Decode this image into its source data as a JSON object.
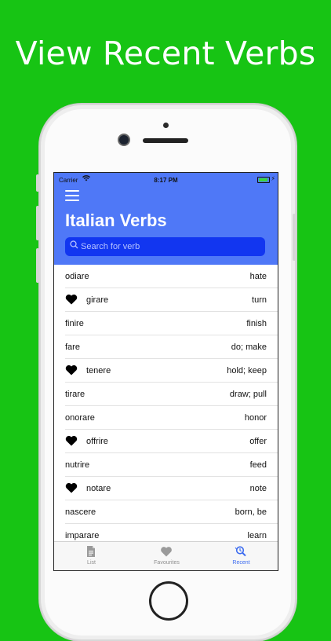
{
  "headline": "View Recent Verbs",
  "status": {
    "carrier": "Carrier",
    "time": "8:17 PM",
    "battery_level": 0.95
  },
  "app": {
    "title": "Italian Verbs"
  },
  "search": {
    "placeholder": "Search for verb",
    "value": ""
  },
  "verbs": [
    {
      "verb": "odiare",
      "meaning": "hate",
      "favourite": false
    },
    {
      "verb": "girare",
      "meaning": "turn",
      "favourite": true
    },
    {
      "verb": "finire",
      "meaning": "finish",
      "favourite": false
    },
    {
      "verb": "fare",
      "meaning": "do; make",
      "favourite": false
    },
    {
      "verb": "tenere",
      "meaning": "hold; keep",
      "favourite": true
    },
    {
      "verb": "tirare",
      "meaning": "draw; pull",
      "favourite": false
    },
    {
      "verb": "onorare",
      "meaning": "honor",
      "favourite": false
    },
    {
      "verb": "offrire",
      "meaning": "offer",
      "favourite": true
    },
    {
      "verb": "nutrire",
      "meaning": "feed",
      "favourite": false
    },
    {
      "verb": "notare",
      "meaning": "note",
      "favourite": true
    },
    {
      "verb": "nascere",
      "meaning": "born, be",
      "favourite": false
    },
    {
      "verb": "imparare",
      "meaning": "learn",
      "favourite": false
    }
  ],
  "tabs": [
    {
      "label": "List",
      "icon": "document-icon",
      "active": false
    },
    {
      "label": "Favourites",
      "icon": "heart-icon",
      "active": false
    },
    {
      "label": "Recent",
      "icon": "recent-search-icon",
      "active": true
    }
  ],
  "colors": {
    "background": "#17c414",
    "header": "#4f78f7",
    "search": "#1236f0",
    "active_tab": "#3d6cf0"
  }
}
